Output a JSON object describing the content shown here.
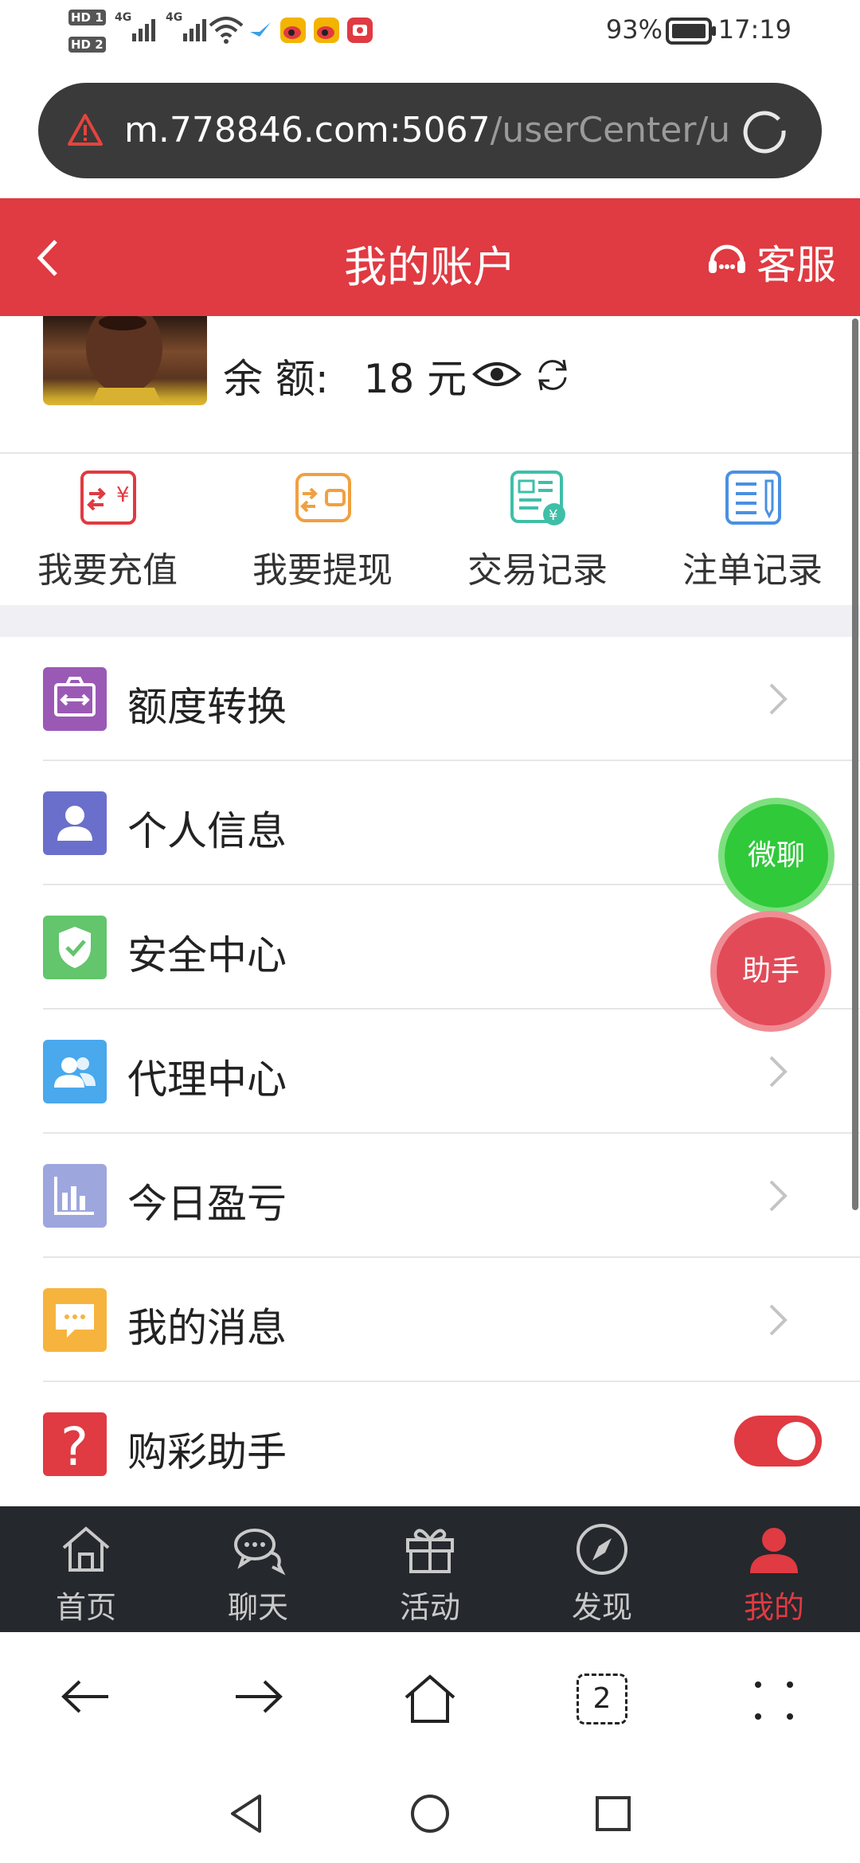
{
  "status_bar": {
    "sim1": "HD 1",
    "sim2": "HD 2",
    "network1": "4G",
    "network2": "4G",
    "battery": "93%",
    "time": "17:19",
    "icons": [
      "signal-icon",
      "signal-icon",
      "wifi-icon",
      "bird-icon",
      "weibo-icon",
      "weibo-icon",
      "app-icon"
    ]
  },
  "browser": {
    "url_main": "m.778846.com:5067",
    "url_rest": "/userCenter/u",
    "warning_icon": "warning-icon",
    "reload_icon": "reload-icon"
  },
  "header": {
    "back_icon": "chevron-left-icon",
    "title": "我的账户",
    "service_label": "客服",
    "service_icon": "headset-icon"
  },
  "account": {
    "balance_label": "余 额:",
    "balance_value": "18 元",
    "eye_icon": "eye-icon",
    "refresh_icon": "refresh-icon"
  },
  "quick_actions": [
    {
      "label": "我要充值",
      "icon": "recharge-icon",
      "color": "#e03a42"
    },
    {
      "label": "我要提现",
      "icon": "withdraw-icon",
      "color": "#f0a040"
    },
    {
      "label": "交易记录",
      "icon": "transaction-icon",
      "color": "#3fbfa8"
    },
    {
      "label": "注单记录",
      "icon": "bet-record-icon",
      "color": "#4a90e2"
    }
  ],
  "menu": [
    {
      "label": "额度转换",
      "icon": "transfer-icon",
      "color": "#9b59b6"
    },
    {
      "label": "个人信息",
      "icon": "user-icon",
      "color": "#6a6fcb"
    },
    {
      "label": "安全中心",
      "icon": "shield-icon",
      "color": "#63c56c"
    },
    {
      "label": "代理中心",
      "icon": "agents-icon",
      "color": "#4aa8ec"
    },
    {
      "label": "今日盈亏",
      "icon": "chart-icon",
      "color": "#9ea6de"
    },
    {
      "label": "我的消息",
      "icon": "message-icon",
      "color": "#f6b43e"
    },
    {
      "label": "购彩助手",
      "icon": "question-icon",
      "color": "#e03a42",
      "toggle": true
    }
  ],
  "floating": {
    "wechat": "微聊",
    "helper": "助手"
  },
  "bottom_nav": [
    {
      "label": "首页",
      "icon": "home-icon"
    },
    {
      "label": "聊天",
      "icon": "chat-icon"
    },
    {
      "label": "活动",
      "icon": "gift-icon"
    },
    {
      "label": "发现",
      "icon": "compass-icon"
    },
    {
      "label": "我的",
      "icon": "profile-icon",
      "active": true
    }
  ],
  "browser_nav": {
    "tabs_count": "2",
    "icons": [
      "back-arrow-icon",
      "forward-arrow-icon",
      "home-outline-icon",
      "tabs-icon",
      "more-icon"
    ]
  },
  "colors": {
    "brand": "#e03a42",
    "nav_bg": "#25282d",
    "url_bg": "#3a3a3a"
  }
}
